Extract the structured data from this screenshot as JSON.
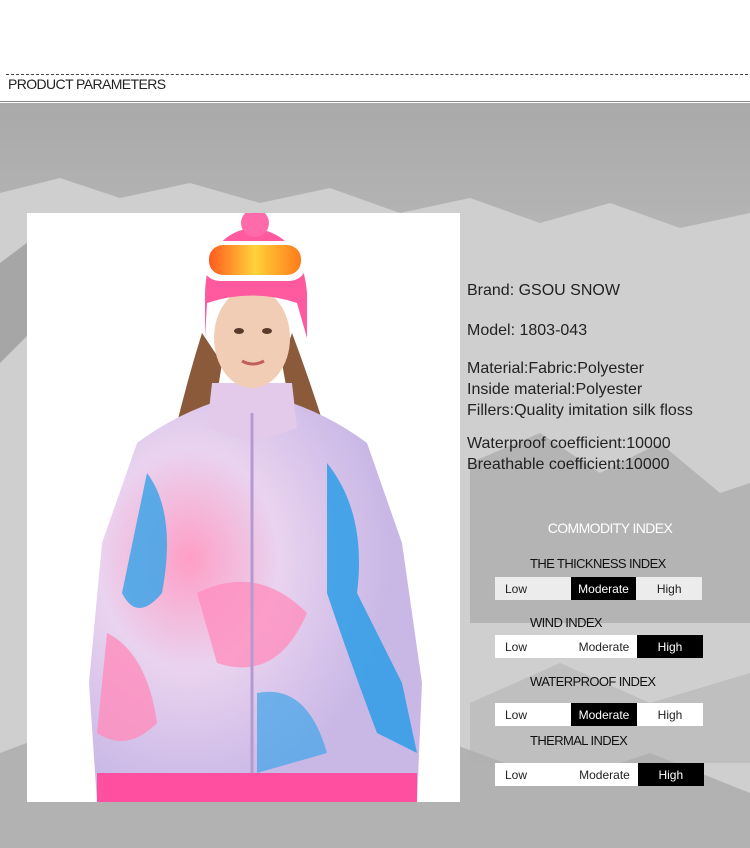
{
  "header": {
    "title": "PRODUCT PARAMETERS"
  },
  "specs": {
    "brand": "Brand:   GSOU SNOW",
    "model": "Model:   1803-043",
    "material": "Material:Fabric:Polyester",
    "inside": "Inside material:Polyester",
    "fillers": "Fillers:Quality imitation silk floss",
    "waterproof": "Waterproof coefficient:10000",
    "breathable": "Breathable coefficient:10000"
  },
  "commodity": {
    "title": "COMMODITY INDEX",
    "indices": [
      {
        "name": "THE THICKNESS INDEX",
        "levels": [
          "Low",
          "Moderate",
          "High"
        ],
        "selected": "Moderate"
      },
      {
        "name": "WIND INDEX",
        "levels": [
          "Low",
          "Moderate",
          "High"
        ],
        "selected": "High"
      },
      {
        "name": "WATERPROOF INDEX",
        "levels": [
          "Low",
          "Moderate",
          "High"
        ],
        "selected": "Moderate"
      },
      {
        "name": "THERMAL INDEX",
        "levels": [
          "Low",
          "Moderate",
          "High"
        ],
        "selected": "High"
      }
    ]
  },
  "colors": {
    "active": "#000000",
    "inactive": "#ffffff",
    "title_on_photo": "#ffffff"
  }
}
